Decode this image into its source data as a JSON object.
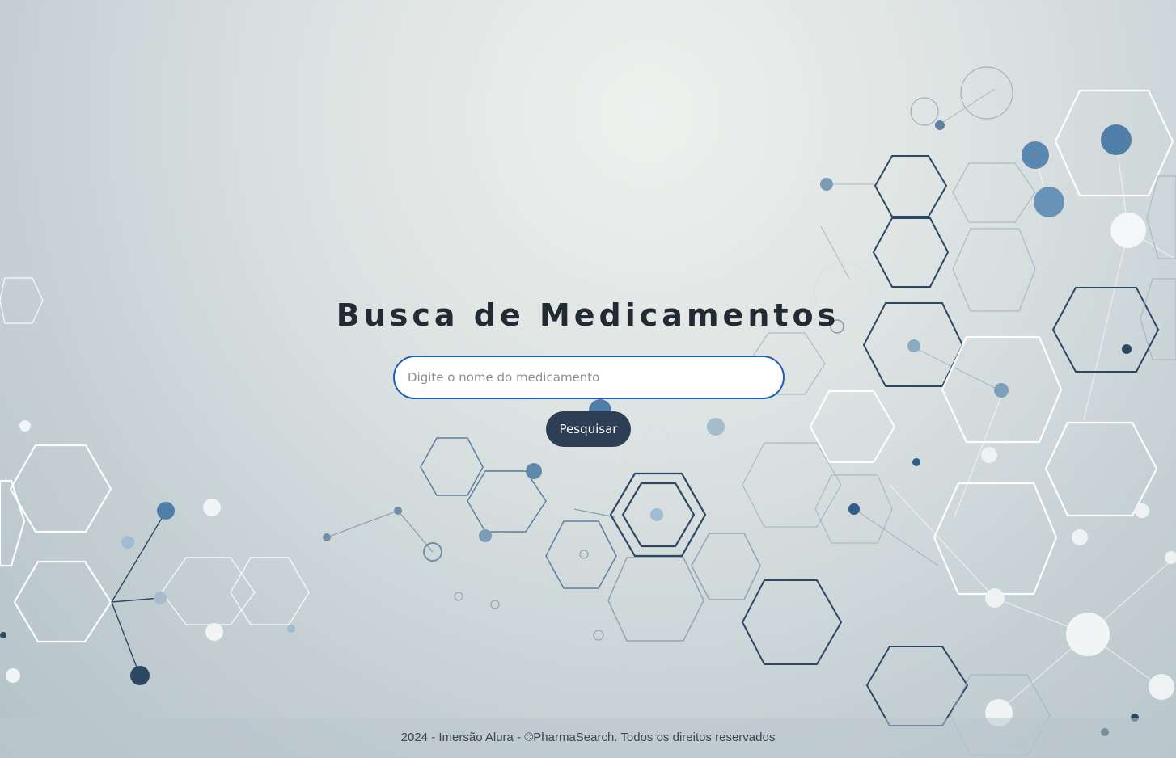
{
  "header": {
    "title": "Busca de Medicamentos"
  },
  "search": {
    "placeholder": "Digite o nome do medicamento",
    "value": "",
    "button_label": "Pesquisar"
  },
  "footer": {
    "text": "2024 - Imersão Alura - ©PharmaSearch. Todos os direitos reservados"
  },
  "colors": {
    "input_border": "#1b5fb8",
    "button_background": "#2d3e55",
    "title_text": "#222a33",
    "background_tone": "#c5d0d4"
  }
}
